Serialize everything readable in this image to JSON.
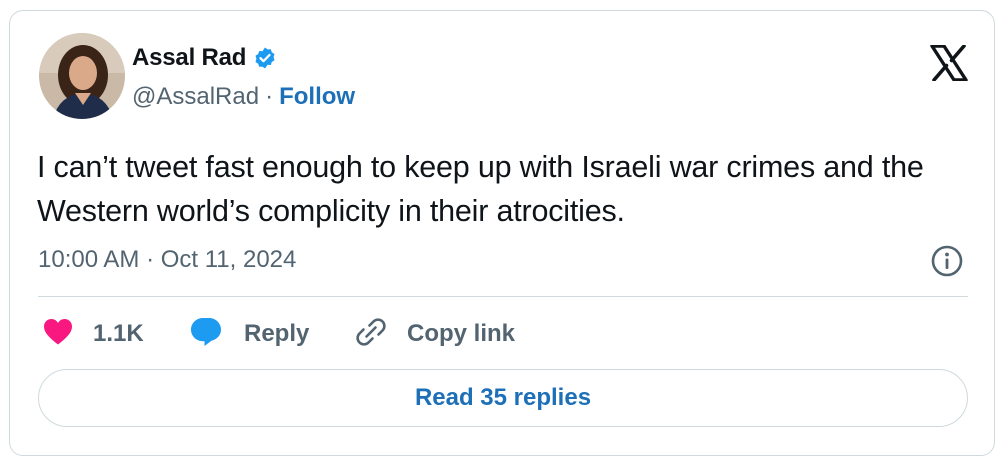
{
  "author": {
    "display_name": "Assal Rad",
    "handle": "@AssalRad",
    "separator": "·",
    "follow_label": "Follow",
    "verified": true,
    "verified_color": "#1d9bf0"
  },
  "tweet": {
    "text": "I can’t tweet fast enough to keep up with Israeli war crimes and the Western world’s complicity in their atrocities.",
    "timestamp": "10:00 AM · Oct 11, 2024"
  },
  "actions": {
    "like_count": "1.1K",
    "like_color": "#f91880",
    "reply_label": "Reply",
    "reply_color": "#1d9bf0",
    "copy_label": "Copy link"
  },
  "footer": {
    "read_replies_label": "Read 35 replies"
  },
  "icons": {
    "brand": "x-logo-icon",
    "info": "info-icon",
    "like": "heart-icon",
    "reply": "speech-bubble-icon",
    "copy": "link-icon"
  }
}
